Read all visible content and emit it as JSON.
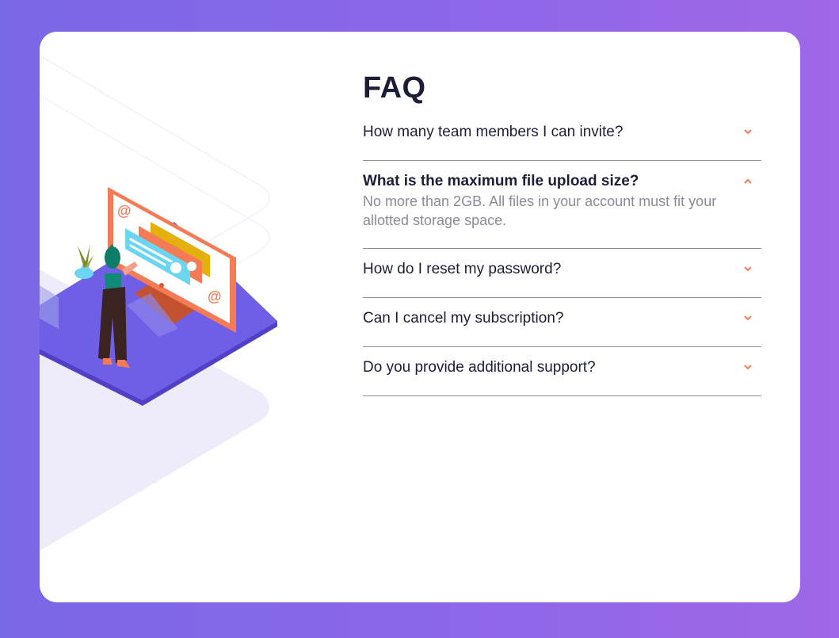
{
  "faq": {
    "title": "FAQ",
    "items": [
      {
        "question": "How many team members I can invite?",
        "open": false
      },
      {
        "question": "What is the maximum file upload size?",
        "open": true,
        "answer": "No more than 2GB. All files in your account must fit your allotted storage space."
      },
      {
        "question": "How do I reset my password?",
        "open": false
      },
      {
        "question": "Can I cancel my subscription?",
        "open": false
      },
      {
        "question": "Do you provide additional support?",
        "open": false
      }
    ]
  },
  "icons": {
    "collapsed": "chevron-down-icon",
    "expanded": "chevron-up-icon"
  },
  "colors": {
    "background_start": "#7a67e6",
    "background_end": "#a067e8",
    "heading": "#1d1e35",
    "answer": "#8b8b95",
    "divider": "#8f8f9a",
    "accent": "#f47b56"
  }
}
